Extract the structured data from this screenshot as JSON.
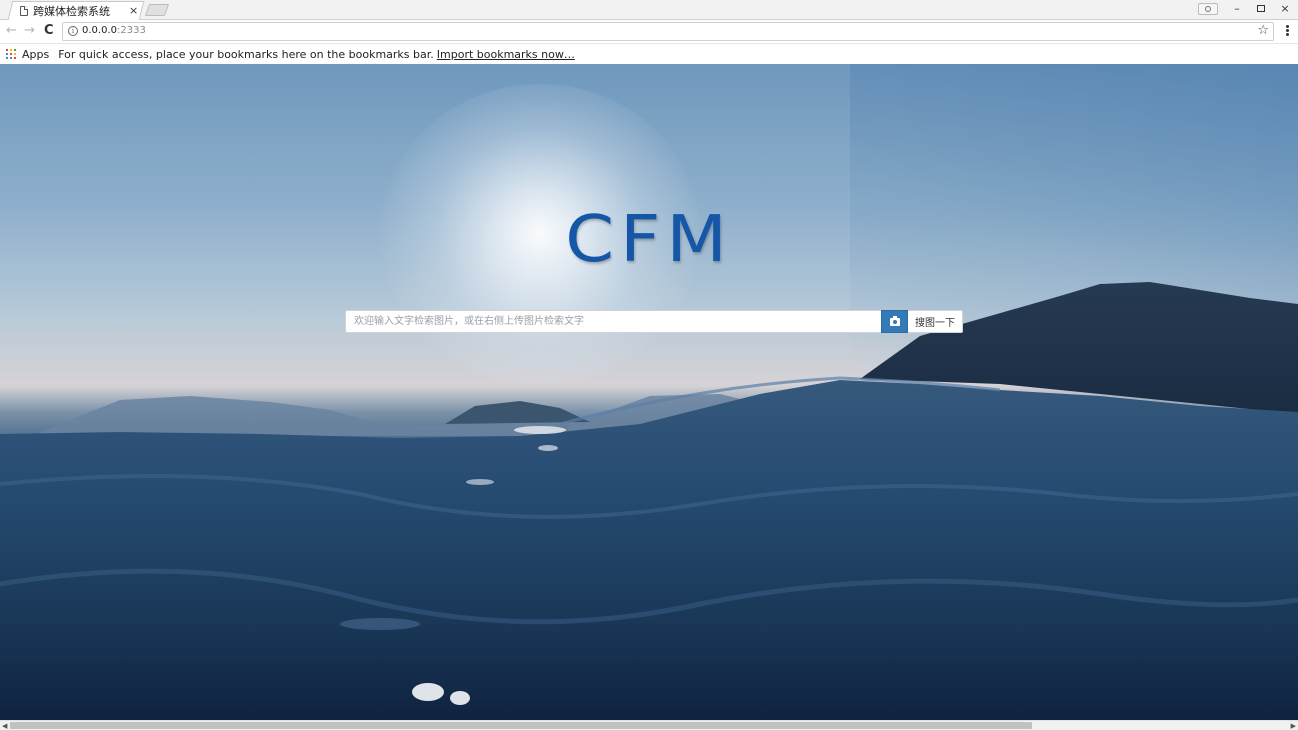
{
  "browser": {
    "tab": {
      "title": "跨媒体检索系统",
      "close_glyph": "×"
    },
    "window_controls": {
      "minimize": "–",
      "close": "×"
    },
    "toolbar": {
      "back": "←",
      "forward": "→",
      "reload": "C",
      "url_host": "0.0.0.0",
      "url_port": ":2333",
      "info_glyph": "i",
      "star": "☆"
    },
    "bookmarks_bar": {
      "apps_label": "Apps",
      "hint": "For quick access, place your bookmarks here on the bookmarks bar.",
      "import_link": "Import bookmarks now…",
      "apps_icon_colors": [
        "#e94335",
        "#fbbc05",
        "#34a853",
        "#4285f4",
        "#e94335",
        "#fbbc05",
        "#34a853",
        "#4285f4",
        "#e94335"
      ]
    }
  },
  "page": {
    "logo_text": "CFM",
    "search": {
      "placeholder": "欢迎输入文字检索图片，或在右侧上传图片检索文字",
      "value": "",
      "camera_icon": "camera-icon",
      "submit_label": "搜图一下"
    }
  },
  "colors": {
    "logo": "#1557a6",
    "camera_button": "#337ab7"
  },
  "scrollbar": {
    "left_arrow": "◀",
    "right_arrow": "▶"
  }
}
